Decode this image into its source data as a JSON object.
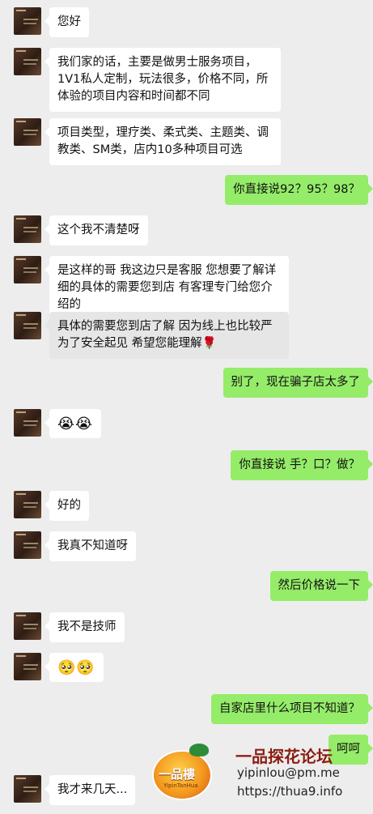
{
  "colors": {
    "background": "#ededed",
    "sent_bubble": "#95ec69",
    "received_bubble": "#ffffff"
  },
  "messages": [
    {
      "side": "left",
      "text": "您好"
    },
    {
      "side": "left",
      "text": "我们家的话，主要是做男士服务项目，1V1私人定制，玩法很多，价格不同，所体验的项目内容和时间都不同"
    },
    {
      "side": "left",
      "text": "项目类型，理疗类、柔式类、主题类、调教类、SM类，店内10多种项目可选"
    },
    {
      "side": "right",
      "text": "你直接说92？95？98？"
    },
    {
      "side": "left",
      "text": "这个我不清楚呀"
    },
    {
      "side": "left",
      "text": "是这样的哥 我这边只是客服 您想要了解详细的具体的需要您到店 有客理专门给您介绍的"
    },
    {
      "side": "left",
      "text": "具体的需要您到店了解 因为线上也比较严 为了安全起见 希望您能理解🌹"
    },
    {
      "side": "right",
      "text": "别了，现在骗子店太多了"
    },
    {
      "side": "left",
      "text": "😭😭"
    },
    {
      "side": "right",
      "text": "你直接说 手？口？做？"
    },
    {
      "side": "left",
      "text": "好的"
    },
    {
      "side": "left",
      "text": "我真不知道呀"
    },
    {
      "side": "right",
      "text": "然后价格说一下"
    },
    {
      "side": "left",
      "text": "我不是技师"
    },
    {
      "side": "left",
      "text": "🥺🥺"
    },
    {
      "side": "right",
      "text": "自家店里什么项目不知道？"
    },
    {
      "side": "right",
      "text": "呵呵"
    },
    {
      "side": "left",
      "text": "我才来几天..."
    }
  ],
  "watermark": {
    "logo_text": "一品樓",
    "logo_sub": "YipinTanHua",
    "title": "一品探花论坛",
    "email": "yipinlou@pm.me",
    "url": "https://thua9.info"
  }
}
